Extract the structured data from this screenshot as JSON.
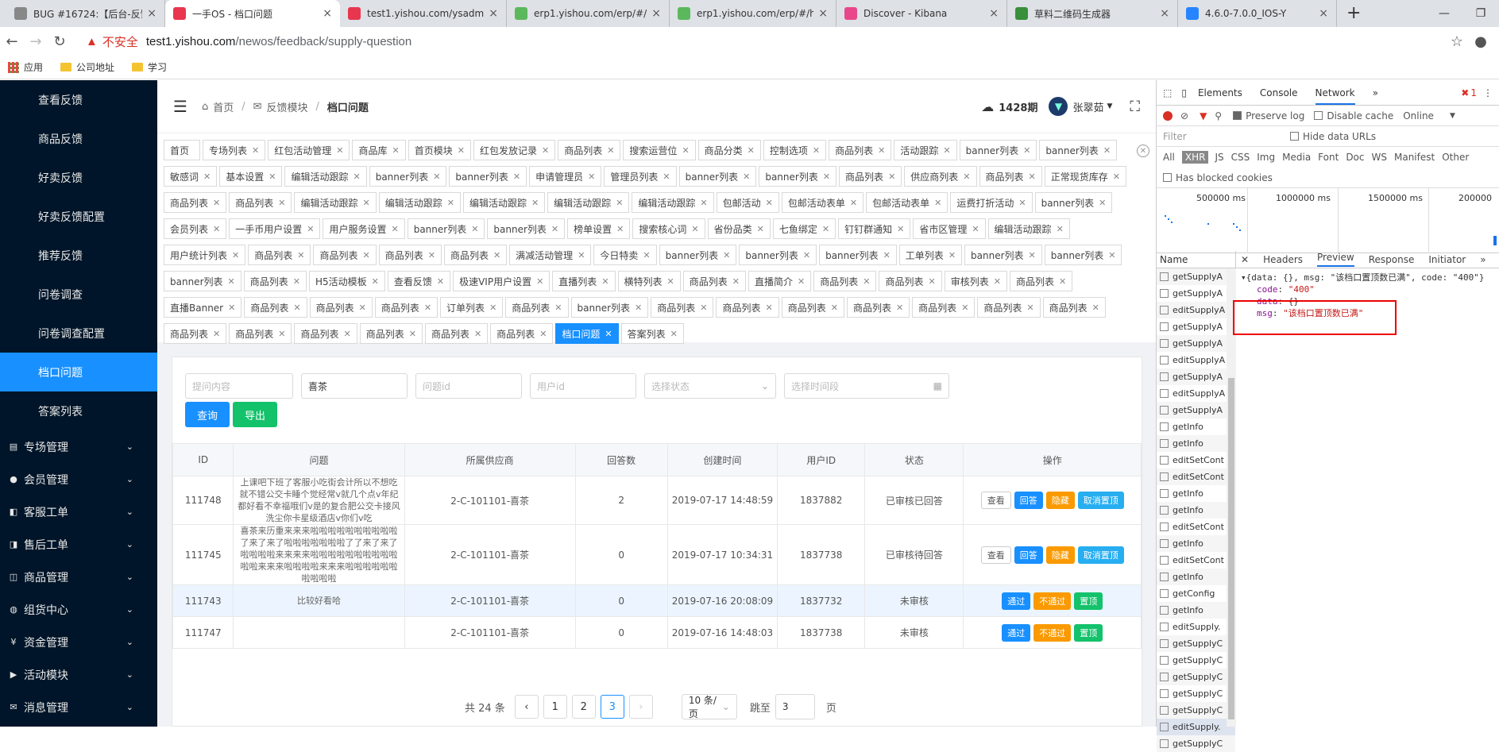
{
  "browser": {
    "tabs": [
      {
        "title": "BUG #16724:【后台-反馈",
        "color": "#888"
      },
      {
        "title": "一手OS - 档口问题",
        "color": "#e8364f",
        "active": true
      },
      {
        "title": "test1.yishou.com/ysadmi",
        "color": "#e8364f"
      },
      {
        "title": "erp1.yishou.com/erp/#/h",
        "color": "#5cb85c"
      },
      {
        "title": "erp1.yishou.com/erp/#/h",
        "color": "#5cb85c"
      },
      {
        "title": "Discover - Kibana",
        "color": "#e8488b"
      },
      {
        "title": "草料二维码生成器",
        "color": "#3a8f3a"
      },
      {
        "title": "4.6.0-7.0.0_IOS-Y",
        "color": "#2684ff"
      }
    ],
    "insecure_label": "不安全",
    "url_host": "test1.yishou.com",
    "url_path": "/newos/feedback/supply-question",
    "bookmarks": [
      "应用",
      "公司地址",
      "学习"
    ]
  },
  "sidebar": {
    "items": [
      "查看反馈",
      "商品反馈",
      "好卖反馈",
      "好卖反馈配置",
      "推荐反馈",
      "问卷调查",
      "问卷调查配置",
      "档口问题",
      "答案列表"
    ],
    "active": "档口问题",
    "groups": [
      "专场管理",
      "会员管理",
      "客服工单",
      "售后工单",
      "商品管理",
      "组货中心",
      "资金管理",
      "活动模块",
      "消息管理"
    ]
  },
  "header": {
    "breadcrumb": [
      "首页",
      "反馈模块",
      "档口问题"
    ],
    "issue": "1428期",
    "user": "张翠茹"
  },
  "tags": [
    "首页",
    "专场列表",
    "红包活动管理",
    "商品库",
    "首页模块",
    "红包发放记录",
    "商品列表",
    "搜索运营位",
    "商品分类",
    "控制选项",
    "商品列表",
    "活动跟踪",
    "banner列表",
    "banner列表",
    "敏感词",
    "基本设置",
    "编辑活动跟踪",
    "banner列表",
    "banner列表",
    "申请管理员",
    "管理员列表",
    "banner列表",
    "banner列表",
    "商品列表",
    "供应商列表",
    "商品列表",
    "正常现货库存",
    "商品列表",
    "商品列表",
    "编辑活动跟踪",
    "编辑活动跟踪",
    "编辑活动跟踪",
    "编辑活动跟踪",
    "编辑活动跟踪",
    "包邮活动",
    "包邮活动表单",
    "包邮活动表单",
    "运费打折活动",
    "banner列表",
    "会员列表",
    "一手币用户设置",
    "用户服务设置",
    "banner列表",
    "banner列表",
    "榜单设置",
    "搜索核心词",
    "省份品类",
    "七鱼绑定",
    "钉钉群通知",
    "省市区管理",
    "编辑活动跟踪",
    "用户统计列表",
    "商品列表",
    "商品列表",
    "商品列表",
    "商品列表",
    "满减活动管理",
    "今日特卖",
    "banner列表",
    "banner列表",
    "banner列表",
    "工单列表",
    "banner列表",
    "banner列表",
    "banner列表",
    "商品列表",
    "H5活动模板",
    "查看反馈",
    "极速VIP用户设置",
    "直播列表",
    "横特列表",
    "商品列表",
    "直播简介",
    "商品列表",
    "商品列表",
    "审核列表",
    "商品列表",
    "直播Banner",
    "商品列表",
    "商品列表",
    "商品列表",
    "订单列表",
    "商品列表",
    "banner列表",
    "商品列表",
    "商品列表",
    "商品列表",
    "商品列表",
    "商品列表",
    "商品列表",
    "商品列表",
    "商品列表",
    "商品列表",
    "商品列表",
    "商品列表",
    "商品列表",
    "商品列表",
    "档口问题",
    "答案列表"
  ],
  "active_tag": "档口问题",
  "filters": {
    "question_placeholder": "提问内容",
    "supplier_value": "喜茶",
    "qid_placeholder": "问题id",
    "uid_placeholder": "用户id",
    "status_placeholder": "选择状态",
    "time_placeholder": "选择时间段",
    "search_label": "查询",
    "export_label": "导出"
  },
  "table": {
    "headers": [
      "ID",
      "问题",
      "所属供应商",
      "回答数",
      "创建时间",
      "用户ID",
      "状态",
      "操作"
    ],
    "rows": [
      {
        "id": "111748",
        "question": "上课吧下班了客服小吃街会计所以不想吃就不错公交卡睡个觉经常v就几个点v年纪都好看不幸福哦们v是的复合肥公交卡接风洗尘你卡星级酒店v你们v吃",
        "supplier": "2-C-101101-喜茶",
        "answers": "2",
        "created": "2019-07-17 14:48:59",
        "uid": "1837882",
        "status": "已审核已回答",
        "ops": [
          [
            "查看",
            "def"
          ],
          [
            "回答",
            "b"
          ],
          [
            "隐藏",
            "o"
          ],
          [
            "取消置顶",
            "c"
          ]
        ]
      },
      {
        "id": "111745",
        "question": "喜茶来历重来来来啦啦啦啦啦啦啦啦啦啦了来了来了啦啦啦啦啦啦啦了了来了来了啦啦啦啦来来来来啦啦啦啦啦啦啦啦啦啦啦啦来来来啦啦啦啦来来来啦啦啦啦啦啦啦啦啦啦",
        "supplier": "2-C-101101-喜茶",
        "answers": "0",
        "created": "2019-07-17 10:34:31",
        "uid": "1837738",
        "status": "已审核待回答",
        "ops": [
          [
            "查看",
            "def"
          ],
          [
            "回答",
            "b"
          ],
          [
            "隐藏",
            "o"
          ],
          [
            "取消置顶",
            "c"
          ]
        ]
      },
      {
        "id": "111743",
        "question": "比较好看哈",
        "supplier": "2-C-101101-喜茶",
        "answers": "0",
        "created": "2019-07-16 20:08:09",
        "uid": "1837732",
        "status": "未审核",
        "ops": [
          [
            "通过",
            "b"
          ],
          [
            "不通过",
            "o"
          ],
          [
            "置顶",
            "g"
          ]
        ]
      },
      {
        "id": "111747",
        "question": "",
        "supplier": "2-C-101101-喜茶",
        "answers": "0",
        "created": "2019-07-16 14:48:03",
        "uid": "1837738",
        "status": "未审核",
        "ops": [
          [
            "通过",
            "b"
          ],
          [
            "不通过",
            "o"
          ],
          [
            "置顶",
            "g"
          ]
        ]
      }
    ]
  },
  "pagination": {
    "total": "共 24 条",
    "pages": [
      "1",
      "2",
      "3"
    ],
    "current": "3",
    "page_size": "10 条/页",
    "jump_label": "跳至",
    "jump_value": "3",
    "page_unit": "页"
  },
  "devtools": {
    "tabs": [
      "Elements",
      "Console",
      "Network"
    ],
    "preserve_log": "Preserve log",
    "disable_cache": "Disable cache",
    "online": "Online",
    "filter_placeholder": "Filter",
    "hide_data_urls": "Hide data URLs",
    "types": [
      "All",
      "XHR",
      "JS",
      "CSS",
      "Img",
      "Media",
      "Font",
      "Doc",
      "WS",
      "Manifest",
      "Other"
    ],
    "blocked_cookies": "Has blocked cookies",
    "timeline": [
      "500000 ms",
      "1000000 ms",
      "1500000 ms",
      "200000"
    ],
    "name_header": "Name",
    "detail_tabs": [
      "Headers",
      "Preview",
      "Response",
      "Initiator"
    ],
    "requests": [
      "getSupplyA",
      "getSupplyA",
      "editSupplyA",
      "getSupplyA",
      "getSupplyA",
      "editSupplyA",
      "getSupplyA",
      "editSupplyA",
      "getSupplyA",
      "getInfo",
      "getInfo",
      "editSetCont",
      "editSetCont",
      "getInfo",
      "getInfo",
      "editSetCont",
      "getInfo",
      "editSetCont",
      "getInfo",
      "getConfig",
      "getInfo",
      "editSupply.",
      "getSupplyC",
      "getSupplyC",
      "getSupplyC",
      "getSupplyC",
      "getSupplyC",
      "editSupply.",
      "getSupplyC"
    ],
    "error_count": "1",
    "json_line": "{data: {}, msg: \"该档口置顶数已满\", code: \"400\"}",
    "code_key": "code",
    "code_val": "\"400\"",
    "data_key": "data",
    "data_val": "{}",
    "msg_key": "msg",
    "msg_val": "\"该档口置顶数已满\""
  }
}
